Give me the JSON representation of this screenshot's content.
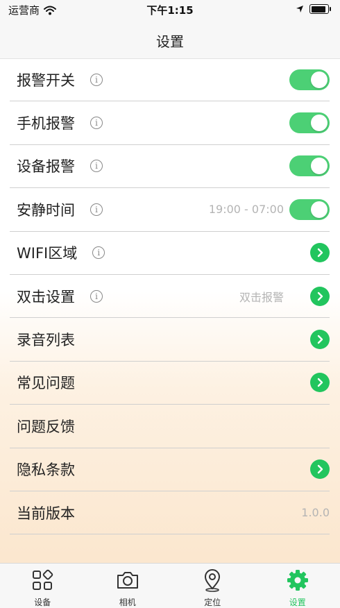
{
  "status_bar": {
    "carrier": "运营商",
    "time": "下午1:15"
  },
  "nav": {
    "title": "设置"
  },
  "settings": [
    {
      "label": "报警开关",
      "info": true,
      "control": "toggle",
      "on": true
    },
    {
      "label": "手机报警",
      "info": true,
      "control": "toggle",
      "on": true
    },
    {
      "label": "设备报警",
      "info": true,
      "control": "toggle",
      "on": true
    },
    {
      "label": "安静时间",
      "info": true,
      "value": "19:00 - 07:00",
      "control": "toggle",
      "on": true
    },
    {
      "label": "WIFI区域",
      "info": true,
      "control": "chevron"
    },
    {
      "label": "双击设置",
      "info": true,
      "value": "双击报警",
      "control": "chevron"
    },
    {
      "label": "录音列表",
      "control": "chevron"
    },
    {
      "label": "常见问题",
      "control": "chevron"
    },
    {
      "label": "问题反馈"
    },
    {
      "label": "隐私条款",
      "control": "chevron"
    },
    {
      "label": "当前版本",
      "value": "1.0.0"
    }
  ],
  "tabs": [
    {
      "label": "设备",
      "icon": "grid-icon",
      "active": false
    },
    {
      "label": "相机",
      "icon": "camera-icon",
      "active": false
    },
    {
      "label": "定位",
      "icon": "location-pin-icon",
      "active": false
    },
    {
      "label": "设置",
      "icon": "gear-icon",
      "active": true
    }
  ],
  "colors": {
    "accent": "#22c55e",
    "toggle_on": "#4cd075",
    "muted_text": "#b4b4b4"
  }
}
